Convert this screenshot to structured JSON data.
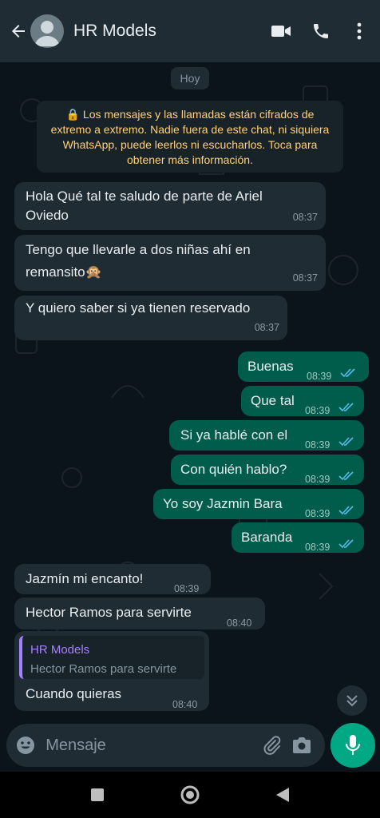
{
  "header": {
    "title": "HR Models"
  },
  "chat": {
    "date_chip": "Hoy",
    "encryption_notice": "🔒 Los mensajes y las llamadas están cifrados de extremo a extremo. Nadie fuera de este chat, ni siquiera WhatsApp, puede leerlos ni escucharlos. Toca para obtener más información.",
    "messages": [
      {
        "direction": "in",
        "lines": [
          "Hola Qué tal te saludo de parte de Ariel",
          "Oviedo"
        ],
        "time": "08:37"
      },
      {
        "direction": "in",
        "lines": [
          "Tengo que llevarle a dos niñas ahí en",
          "remansito🙊"
        ],
        "time": "08:37"
      },
      {
        "direction": "in",
        "text": "Y quiero saber si ya tienen reservado",
        "time": "08:37"
      },
      {
        "direction": "out",
        "text": "Buenas",
        "time": "08:39",
        "status": "read"
      },
      {
        "direction": "out",
        "text": "Que tal",
        "time": "08:39",
        "status": "read"
      },
      {
        "direction": "out",
        "text": "Si ya hablé con el",
        "time": "08:39",
        "status": "read"
      },
      {
        "direction": "out",
        "text": "Con quién hablo?",
        "time": "08:39",
        "status": "read"
      },
      {
        "direction": "out",
        "text": "Yo soy Jazmin Bara",
        "time": "08:39",
        "status": "read"
      },
      {
        "direction": "out",
        "text": "Baranda",
        "time": "08:39",
        "status": "read"
      },
      {
        "direction": "in",
        "text": "Jazmín mi encanto!",
        "time": "08:39"
      },
      {
        "direction": "in",
        "text": "Hector Ramos para servirte",
        "time": "08:40"
      },
      {
        "direction": "in",
        "text": "Cuando quieras",
        "time": "08:40",
        "reply": {
          "author": "HR Models",
          "text": "Hector Ramos para servirte"
        }
      }
    ]
  },
  "composer": {
    "placeholder": "Mensaje"
  },
  "colors": {
    "header": "#1f2c34",
    "background": "#0b141a",
    "incoming": "#1f2c34",
    "outgoing": "#005c4b",
    "accent": "#00a884",
    "read_ticks": "#53bdeb",
    "notice_text": "#ffd279"
  }
}
